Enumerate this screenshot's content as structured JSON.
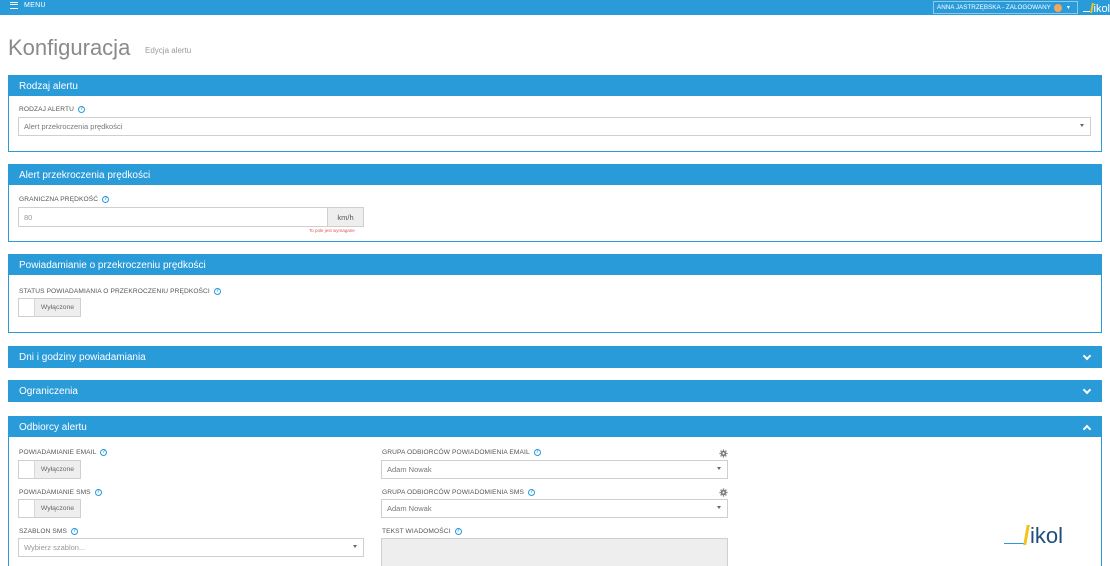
{
  "topbar": {
    "menu_label": "MENU",
    "user_label": "ANNA JASTRZĘBSKA - ZALOGOWANY",
    "logo_text": "ikol",
    "color": "#2a9bd9"
  },
  "page": {
    "title": "Konfiguracja",
    "subtitle": "Edycja alertu"
  },
  "panels": {
    "rodzaj": {
      "title": "Rodzaj alertu",
      "field_label": "RODZAJ ALERTU",
      "field_value": "Alert przekroczenia prędkości"
    },
    "alert": {
      "title": "Alert przekroczenia prędkości",
      "field_label": "GRANICZNA PRĘDKOŚĆ",
      "field_value": "80",
      "unit": "km/h",
      "error": "To pole jest wymagane"
    },
    "powiadamianie": {
      "title": "Powiadamianie o przekroczeniu prędkości",
      "field_label": "STATUS POWIADAMIANIA O PRZEKROCZENIU PRĘDKOŚCI",
      "toggle_label": "Wyłączone"
    },
    "dni": {
      "title": "Dni i godziny powiadamiania"
    },
    "ograniczenia": {
      "title": "Ograniczenia"
    },
    "odbiorcy": {
      "title": "Odbiorcy alertu",
      "email_label": "POWIADAMIANIE EMAIL",
      "email_toggle": "Wyłączone",
      "sms_label": "POWIADAMIANIE SMS",
      "sms_toggle": "Wyłączone",
      "szablon_label": "SZABLON SMS",
      "szablon_placeholder": "Wybierz szablon...",
      "grupa_email_label": "GRUPA ODBIORCÓW POWIADOMIENIA EMAIL",
      "grupa_email_value": "Adam Nowak",
      "grupa_sms_label": "GRUPA ODBIORCÓW POWIADOMIENIA SMS",
      "grupa_sms_value": "Adam Nowak",
      "tekst_label": "TEKST WIADOMOŚCI"
    }
  },
  "icons": {
    "help": "question-circle-icon",
    "gear": "gear-icon",
    "chevron_down": "chevron-down-icon",
    "chevron_up": "chevron-up-icon"
  },
  "logo_text": "ikol"
}
